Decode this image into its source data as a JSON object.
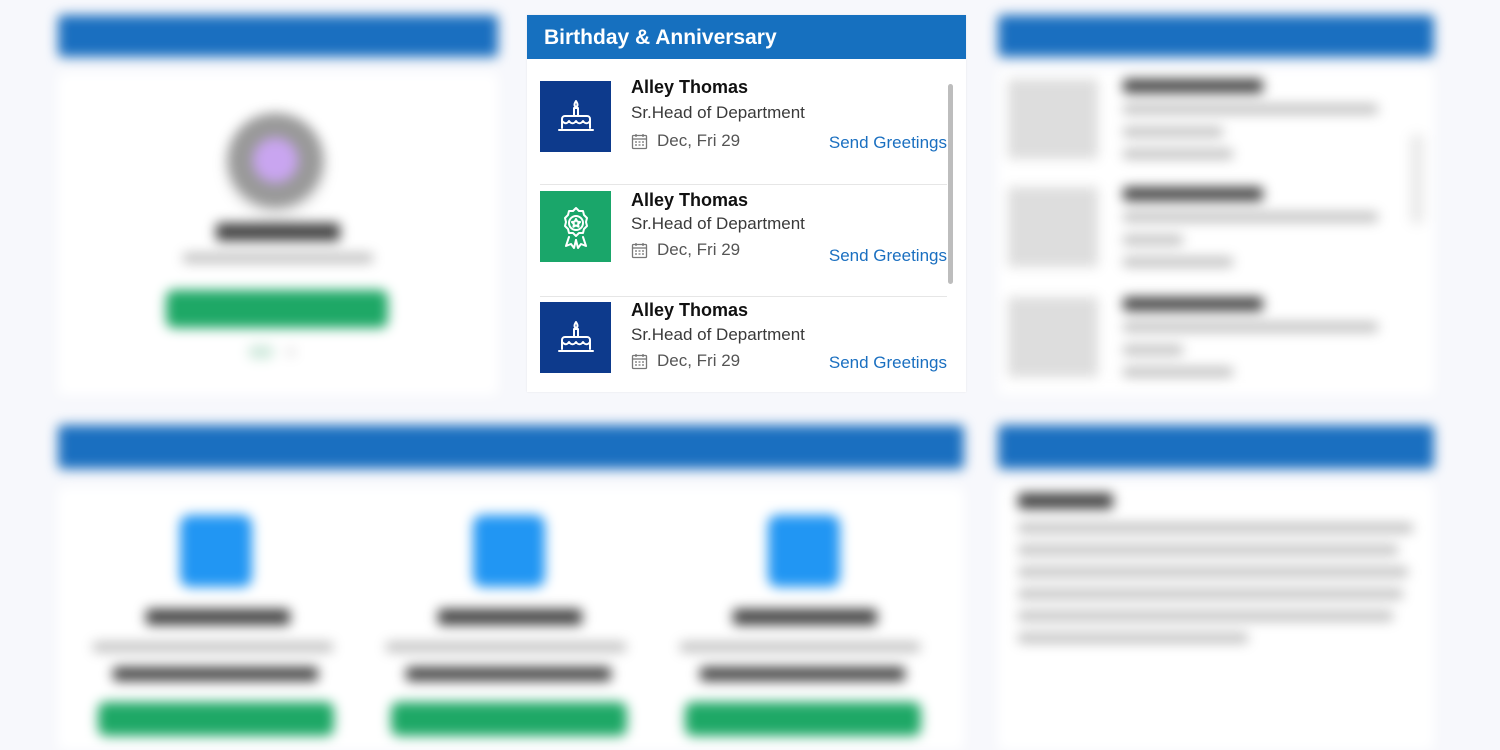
{
  "birthday": {
    "title": "Birthday & Anniversary",
    "send_label": "Send Greetings",
    "entries": [
      {
        "icon": "birthday-cake-icon",
        "name": "Alley Thomas",
        "role": "Sr.Head of Department",
        "date": "Dec, Fri 29"
      },
      {
        "icon": "award-badge-icon",
        "name": "Alley Thomas",
        "role": "Sr.Head of Department",
        "date": "Dec, Fri 29"
      },
      {
        "icon": "birthday-cake-icon",
        "name": "Alley Thomas",
        "role": "Sr.Head of Department",
        "date": "Dec, Fri 29"
      }
    ]
  },
  "colors": {
    "header_blue": "#1670bf",
    "tile_navy": "#0d3a8c",
    "tile_green": "#1aa66a",
    "link_blue": "#1a6fc0"
  }
}
